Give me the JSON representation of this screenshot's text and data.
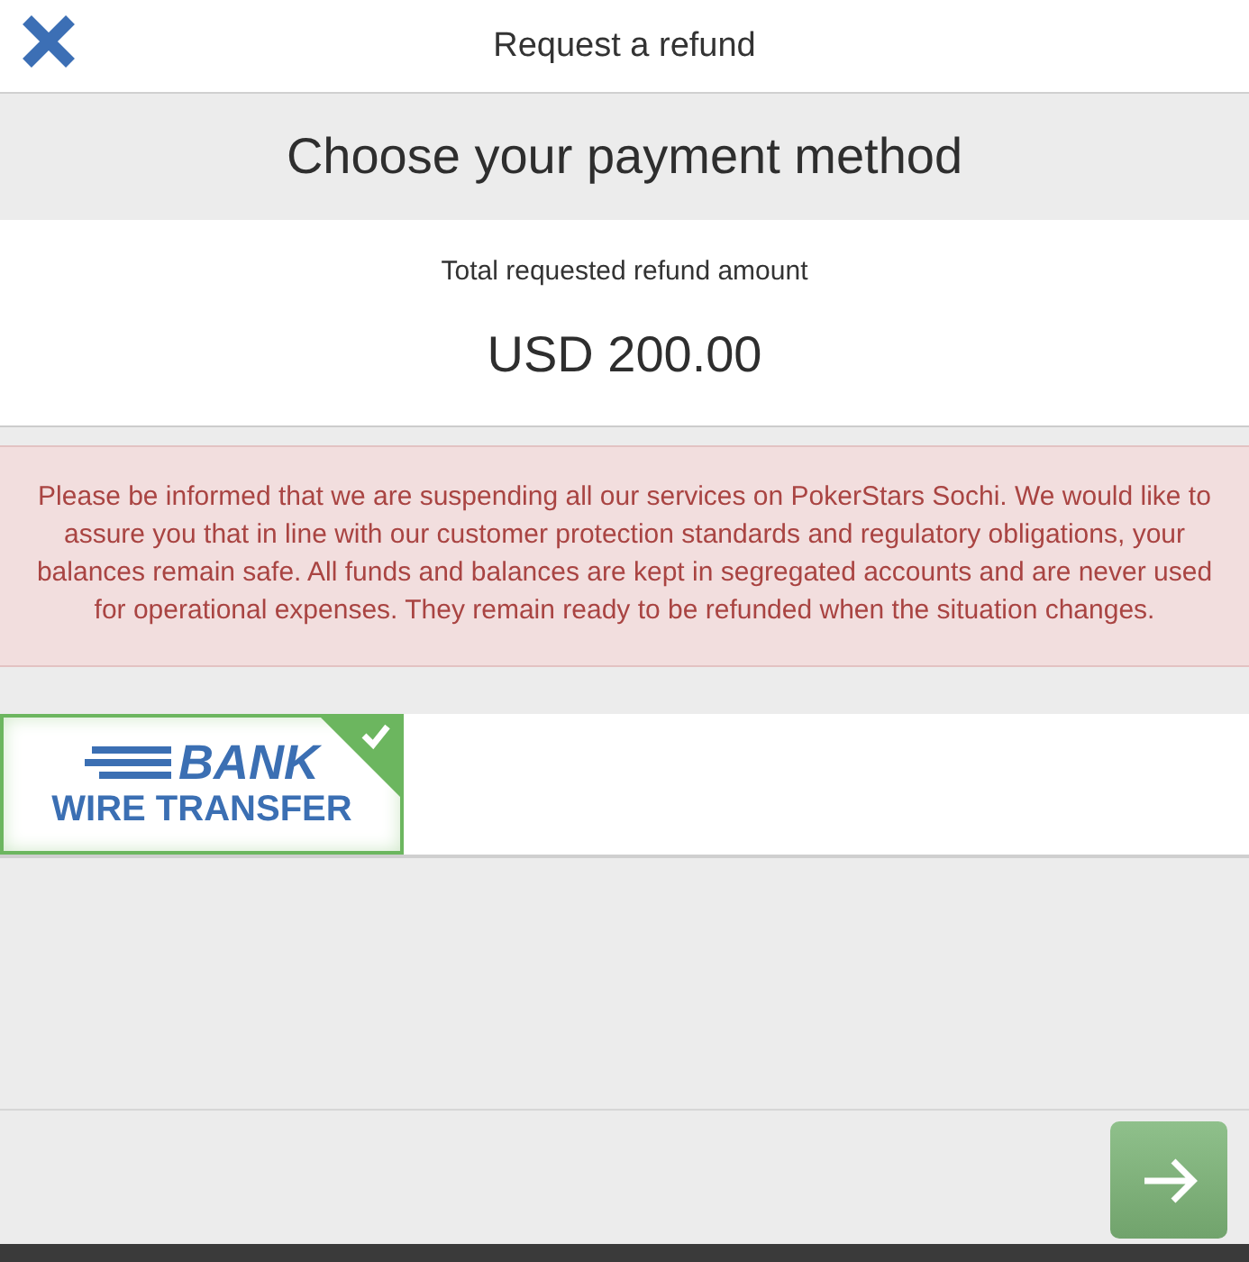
{
  "header": {
    "title": "Request a refund"
  },
  "heading": "Choose your payment method",
  "amount": {
    "label": "Total requested refund amount",
    "value": "USD 200.00"
  },
  "notice": "Please be informed that we are suspending all our services on PokerStars Sochi. We would like to assure you that in line with our customer protection standards and regulatory obligations, your balances remain safe. All funds and balances are kept in segregated accounts and are never used for operational expenses. They remain ready to be refunded when the situation changes.",
  "methods": [
    {
      "line_1": "BANK",
      "line_2": "WIRE TRANSFER",
      "selected": true
    }
  ],
  "next_button": {
    "disabled": false
  }
}
